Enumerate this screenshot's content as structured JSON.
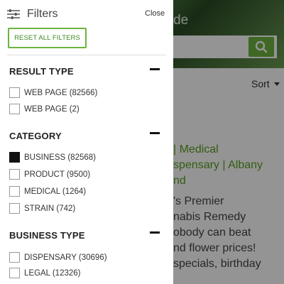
{
  "panel": {
    "title": "Filters",
    "close_label": "Close",
    "reset_label": "RESET ALL FILTERS"
  },
  "sections": [
    {
      "title": "RESULT TYPE",
      "options": [
        {
          "label": "WEB PAGE (82566)",
          "checked": false
        },
        {
          "label": "WEB PAGE (2)",
          "checked": false
        }
      ]
    },
    {
      "title": "CATEGORY",
      "options": [
        {
          "label": "BUSINESS (82568)",
          "checked": true
        },
        {
          "label": "PRODUCT (9500)",
          "checked": false
        },
        {
          "label": "MEDICAL (1264)",
          "checked": false
        },
        {
          "label": "STRAIN (742)",
          "checked": false
        }
      ]
    },
    {
      "title": "BUSINESS TYPE",
      "options": [
        {
          "label": "DISPENSARY (30696)",
          "checked": false
        },
        {
          "label": "LEGAL (12326)",
          "checked": false
        }
      ]
    }
  ],
  "background": {
    "hero_text": "de",
    "sort_label": "Sort",
    "result_title": "| Medical\nspensary | Albany\nnd",
    "result_desc": "'s Premier\nnabis Remedy\nobody can beat\nnd flower prices!\nspecials, birthday"
  },
  "colors": {
    "accent_green": "#6ab43e",
    "link_green": "#5ba11f",
    "overlay": "rgba(0,0,0,0.42)"
  },
  "icons": {
    "filter": "sliders-icon",
    "collapse": "minus-icon",
    "search": "search-icon"
  }
}
